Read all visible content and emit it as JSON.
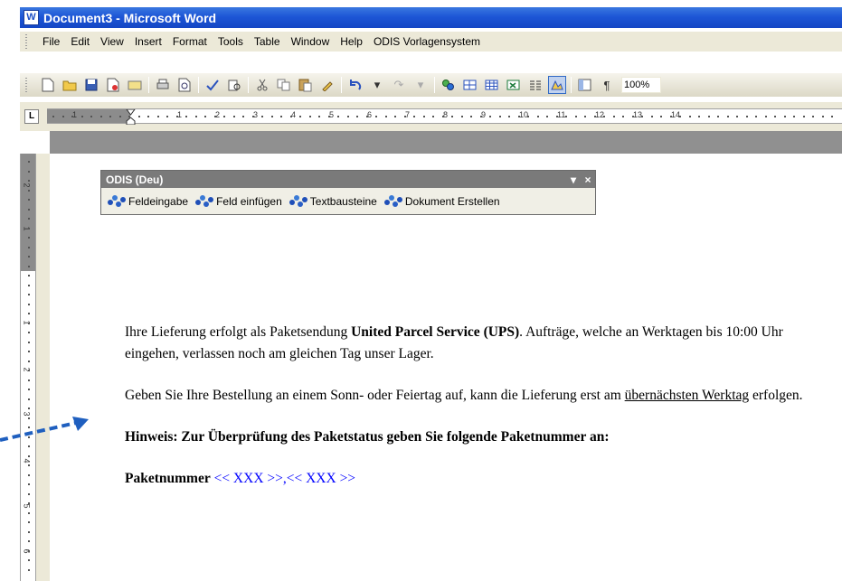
{
  "window": {
    "title": "Document3 - Microsoft Word",
    "app_icon": "W"
  },
  "menu": {
    "items": [
      "File",
      "Edit",
      "View",
      "Insert",
      "Format",
      "Tools",
      "Table",
      "Window",
      "Help",
      "ODIS Vorlagensystem"
    ]
  },
  "toolbar": {
    "icons": [
      "new-icon",
      "open-icon",
      "save-icon",
      "permission-icon",
      "email-icon",
      "print-icon",
      "print-preview-icon",
      "spelling-icon",
      "research-icon",
      "cut-icon",
      "copy-icon",
      "paste-icon",
      "format-painter-icon",
      "undo-icon",
      "redo-icon",
      "hyperlink-icon",
      "tables-borders-icon",
      "insert-table-icon",
      "insert-excel-icon",
      "columns-icon",
      "drawing-icon",
      "document-map-icon",
      "show-hide-icon"
    ],
    "zoom": "100%",
    "pilcrow": "¶"
  },
  "ruler": {
    "tab_selector": "L",
    "h_numbers": [
      "1",
      "1",
      "2",
      "3",
      "4",
      "5",
      "6",
      "7",
      "8",
      "9",
      "10",
      "11",
      "12",
      "13",
      "14"
    ],
    "v_numbers": [
      "2",
      "1",
      "1",
      "2",
      "3",
      "4",
      "5",
      "6"
    ]
  },
  "odis_toolbar": {
    "title": "ODIS (Deu)",
    "dropdown": "▾",
    "close": "×",
    "buttons": [
      "Feldeingabe",
      "Feld einfügen",
      "Textbausteine",
      "Dokument Erstellen"
    ]
  },
  "document": {
    "p1_a": "Ihre Lieferung erfolgt als Paketsendung ",
    "p1_bold": "United Parcel Service (UPS)",
    "p1_b": ". Aufträge, welche an Werktagen bis 10:00 Uhr eingehen, verlassen noch am gleichen Tag unser Lager.",
    "p2_a": "Geben Sie Ihre Bestellung an einem Sonn- oder Feiertag auf, kann die Lieferung erst am ",
    "p2_underline": "übernächsten Werktag",
    "p2_b": " erfolgen.",
    "p3": "Hinweis: Zur Überprüfung des Paketstatus geben Sie folgende Paketnummer an:",
    "p4_label": "Paketnummer",
    "p4_field": " << XXX >>,<< XXX >>"
  },
  "colors": {
    "titlebar": "#1d56d6",
    "field": "#0000ff",
    "arrow": "#1f5fbf"
  }
}
